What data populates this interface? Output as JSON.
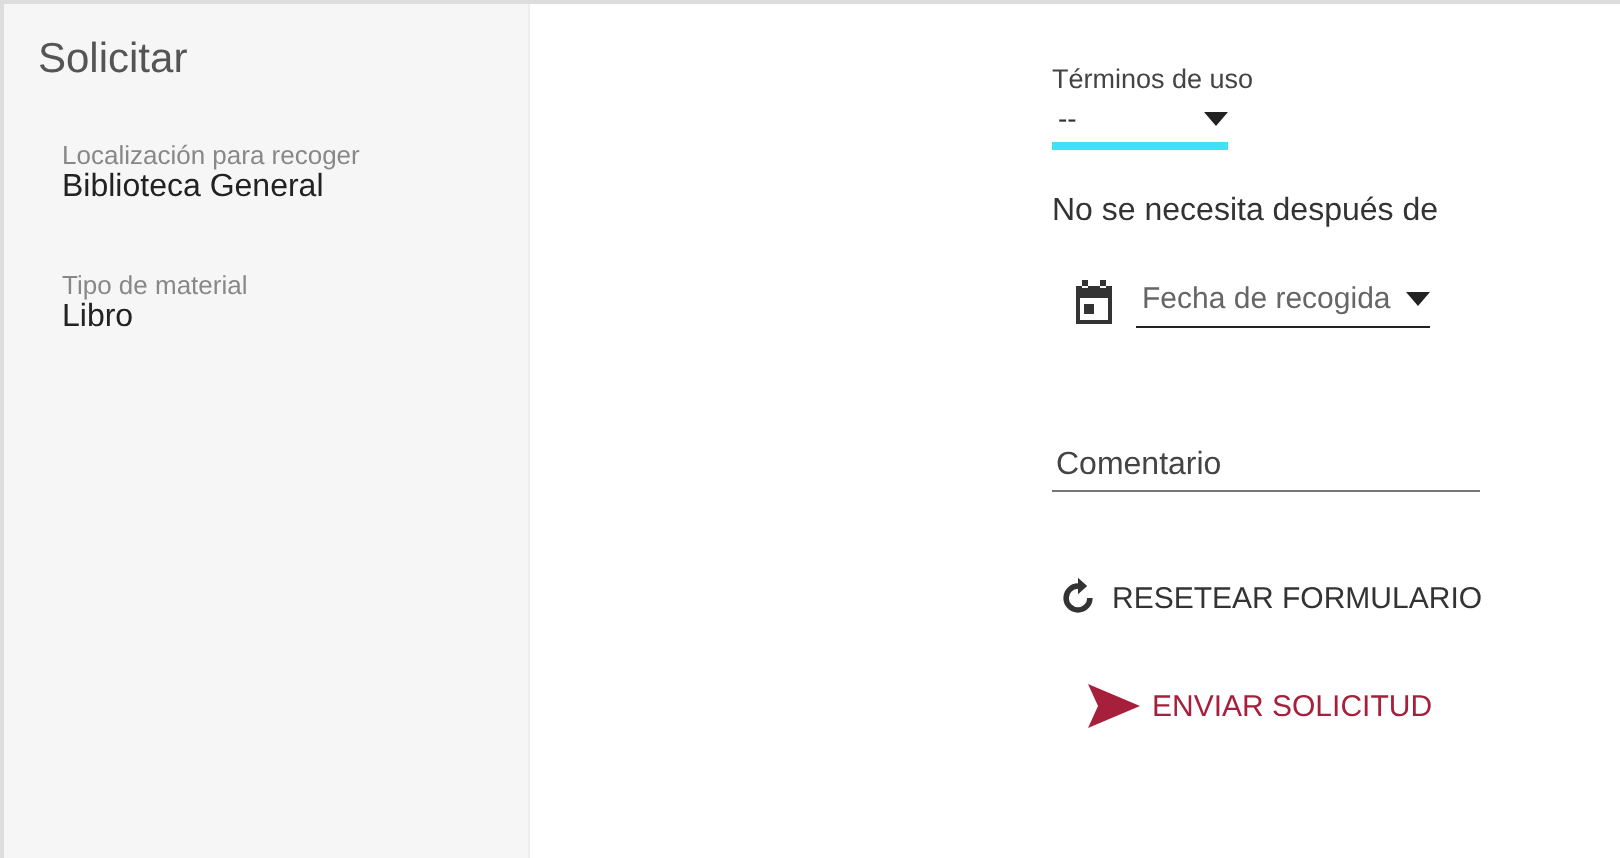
{
  "sidebar": {
    "title": "Solicitar",
    "details": [
      {
        "label": "Localización para recoger",
        "value": "Biblioteca General"
      },
      {
        "label": "Tipo de material",
        "value": "Libro"
      }
    ]
  },
  "form": {
    "terms": {
      "label": "Términos de uso",
      "value": "--",
      "focused": true
    },
    "needed_label": "No se necesita después de",
    "date": {
      "placeholder": "Fecha de recogida"
    },
    "comment": {
      "placeholder": "Comentario"
    },
    "buttons": [
      {
        "kind": "reset",
        "label": "RESETEAR FORMULARIO"
      },
      {
        "kind": "send",
        "label": "ENVIAR SOLICITUD"
      }
    ]
  }
}
